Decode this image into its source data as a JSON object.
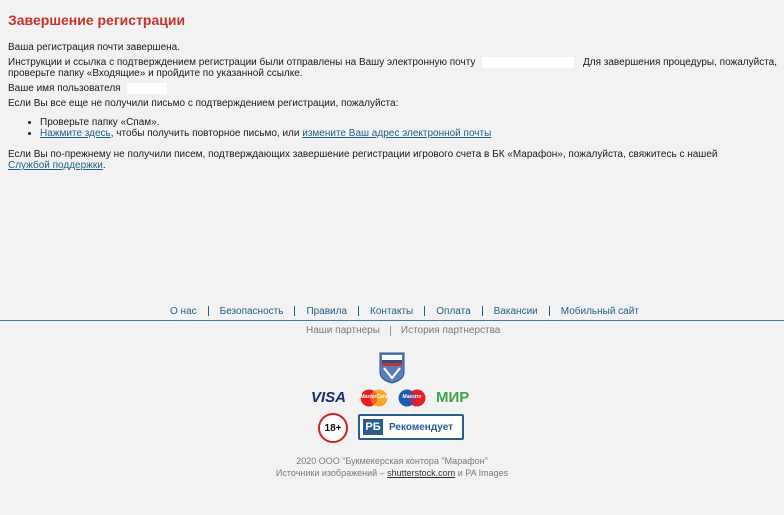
{
  "page": {
    "title": "Завершение регистрации",
    "almost_done": "Ваша регистрация почти завершена.",
    "instructions_line1": "Инструкции и ссылка с подтверждением регистрации были отправлены на Вашу электронную почту",
    "instructions_tail": "Для завершения процедуры, пожалуйста,",
    "instructions_line2": "проверьте папку «Входящие» и пройдите по указанной ссылке.",
    "username_label": "Ваше имя пользователя",
    "not_received": "Если Вы все еще не получили письмо с подтверждением регистрации, пожалуйста:",
    "tips": {
      "check_spam": "Проверьте папку «Спам».",
      "click_here": "Нажмите здесь",
      "resend_text": ", чтобы получить повторное письмо, или",
      "change_email": "измените Ваш адрес электронной почты"
    },
    "support_text": "Если Вы по-прежнему не получили писем, подтверждающих завершение регистрации игрового счета в БК «Марафон», пожалуйста, свяжитесь с нашей",
    "support_link": "Службой поддержки",
    "support_period": "."
  },
  "footer": {
    "nav": [
      "О нас",
      "Безопасность",
      "Правила",
      "Контакты",
      "Оплата",
      "Вакансии",
      "Мобильный сайт"
    ],
    "partners": [
      "Наши партнеры",
      "История партнерства"
    ],
    "payments": {
      "visa": "VISA",
      "mastercard": "MasterCard",
      "maestro": "Maestro",
      "mir": "МИР"
    },
    "age_badge": "18+",
    "rb_mark": "РБ",
    "rb_text": "Рекомендует",
    "copyright": "2020 ООО \"Букмекерская контора \"Марафон\"",
    "sources_prefix": "Источники изображений –",
    "sources_link": "shutterstock.com",
    "sources_suffix": "и PA Images"
  },
  "colors": {
    "title": "#c4342d",
    "link": "#1f5f86",
    "divider": "#3e7aa1",
    "background": "#f2f2f2"
  }
}
